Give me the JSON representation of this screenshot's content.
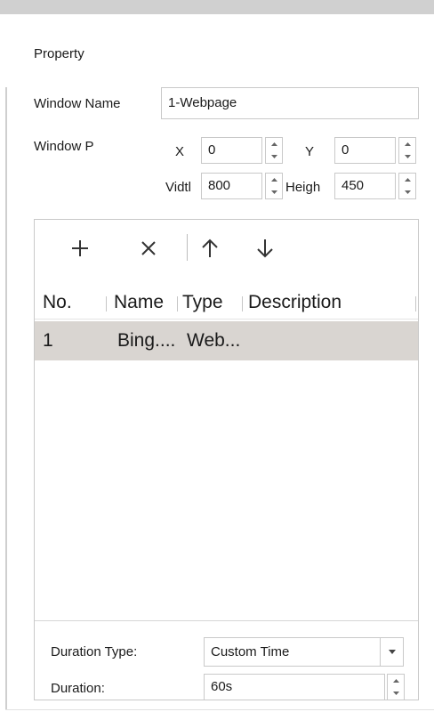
{
  "panel": {
    "section_title": "Property",
    "window_name_label": "Window Name",
    "window_name_value": "1-Webpage",
    "window_pos_label": "Window P",
    "x_label": "X",
    "x_value": "0",
    "y_label": "Y",
    "y_value": "0",
    "width_label": "Vidtl",
    "width_value": "800",
    "height_label": "Heigh",
    "height_value": "450"
  },
  "toolbar": {
    "add_icon": "plus-icon",
    "delete_icon": "close-icon",
    "up_icon": "arrow-up-icon",
    "down_icon": "arrow-down-icon"
  },
  "table": {
    "columns": [
      "No.",
      "Name",
      "Type",
      "Description"
    ],
    "rows": [
      {
        "no": "1",
        "name": "Bing....",
        "type": "Web...",
        "description": ""
      }
    ],
    "selected_row_color": "#d9d5d1"
  },
  "footer": {
    "duration_type_label": "Duration Type:",
    "duration_type_value": "Custom Time",
    "duration_label": "Duration:",
    "duration_value": "60s"
  }
}
